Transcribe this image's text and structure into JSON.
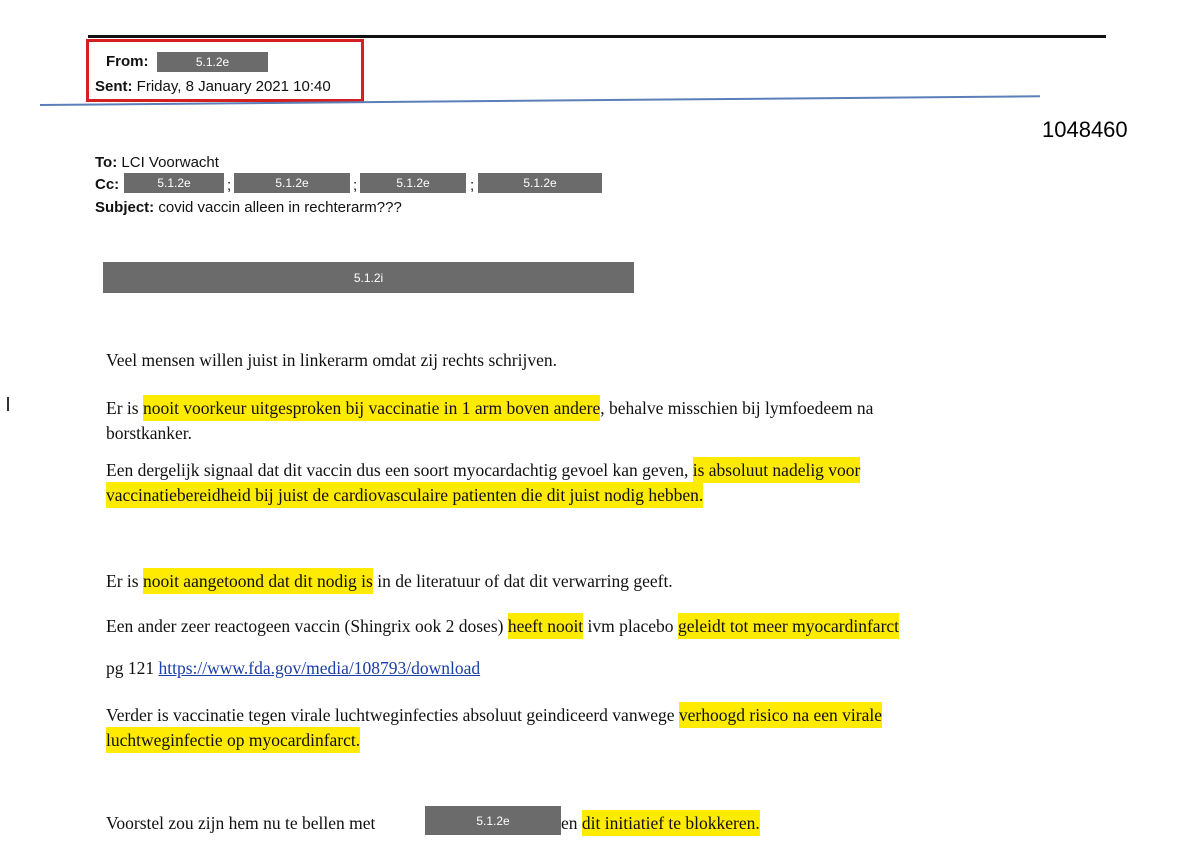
{
  "email": {
    "from_label": "From:",
    "from_redaction": "5.1.2e",
    "sent_label": "Sent:",
    "sent_value": "Friday, 8 January 2021 10:40",
    "to_label": "To:",
    "to_value": "LCI Voorwacht",
    "cc_label": "Cc:",
    "cc_redactions": [
      "5.1.2e",
      "5.1.2e",
      "5.1.2e",
      "5.1.2e"
    ],
    "cc_separator": ";",
    "subject_label": "Subject:",
    "subject_value": "covid vaccin alleen in rechterarm???"
  },
  "doc_number": "1048460",
  "body_redaction": "5.1.2i",
  "body": {
    "p1": "Veel mensen willen juist in linkerarm omdat zij rechts schrijven.",
    "p2a": "Er is ",
    "p2b": "nooit voorkeur uitgesproken bij vaccinatie in 1 arm boven andere",
    "p2c": ", behalve misschien bij lymfoedeem na",
    "p2d": "borstkanker.",
    "p3a": "Een dergelijk signaal dat dit vaccin dus een soort myocardachtig gevoel kan geven, ",
    "p3b": "is absoluut nadelig voor",
    "p3c": "vaccinatiebereidheid bij juist de cardiovasculaire patienten die dit juist nodig hebben.",
    "p4a": "Er is ",
    "p4b": "nooit aangetoond dat dit nodig is",
    "p4c": " in de literatuur of dat dit verwarring geeft.",
    "p5a": "Een ander zeer reactogeen vaccin (Shingrix ook 2 doses) ",
    "p5b": "heeft nooit",
    "p5c": " ivm placebo ",
    "p5d": "geleidt tot meer myocardinfarct",
    "p6a": "pg 121 ",
    "p6link": "https://www.fda.gov/media/108793/download",
    "p7a": "Verder is vaccinatie tegen virale luchtweginfecties absoluut geindiceerd vanwege ",
    "p7b": "verhoogd risico na een virale",
    "p7c": "luchtweginfectie op myocardinfarct.",
    "p8a": "Voorstel zou zijn hem nu te bellen met",
    "p8redaction": "5.1.2e",
    "p8b": " en ",
    "p8c": "dit initiatief te blokkeren."
  },
  "colors": {
    "highlight": "#ffeb00",
    "redaction": "#6b6b6b",
    "box_border": "#d42020",
    "divider_blue": "#5b7fb8",
    "link": "#1a3ea8"
  }
}
